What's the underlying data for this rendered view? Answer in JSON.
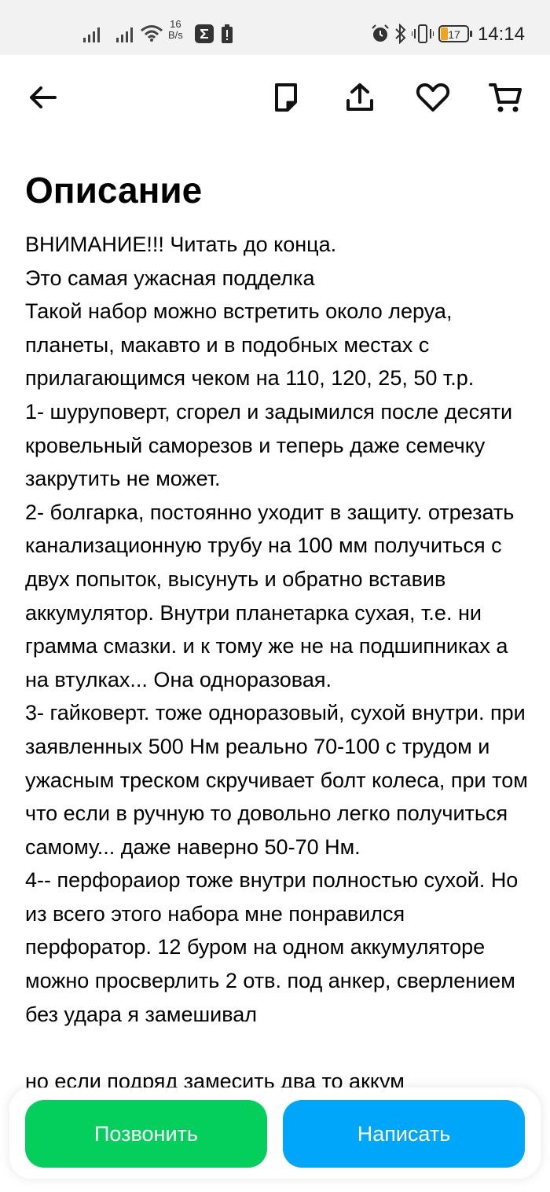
{
  "status_bar": {
    "net_speed_value": "16",
    "net_speed_unit": "B/s",
    "battery_level": "17",
    "time": "14:14",
    "icons": [
      "signal-icon",
      "signal-icon",
      "wifi-icon",
      "sigma-app-icon",
      "battery-warning-icon",
      "alarm-icon",
      "bluetooth-icon",
      "vibrate-icon",
      "battery-icon"
    ]
  },
  "toolbar": {
    "icons": [
      "back-arrow-icon",
      "note-icon",
      "share-icon",
      "favorite-heart-icon",
      "cart-icon"
    ]
  },
  "section": {
    "title": "Описание"
  },
  "description": {
    "text": "ВНИМАНИЕ!!! Читать до конца.\nЭто самая ужасная подделка\nТакой набор можно встретить около леруа, планеты, макавто и в подобных местах с прилагающимся чеком на 110, 120, 25, 50 т.р.\n1- шуруповерт, сгорел и задымился после десяти кровельный саморезов и теперь даже семечку закрутить не может.\n2- болгарка, постоянно уходит в защиту. отрезать канализационную трубу на 100 мм получиться с двух попыток, высунуть и обратно вставив аккумулятор. Внутри планетарка сухая, т.е. ни грамма смазки. и к тому же не на подшипниках а на втулках... Она одноразовая.\n3- гайковерт. тоже одноразовый, сухой внутри. при заявленных 500 Нм реально 70-100 с трудом и ужасным треском скручивает болт колеса, при том что если в ручную то довольно легко получиться самому... даже наверно 50-70 Нм.\n4-- перфораиор тоже внутри полностью сухой. Но из всего этого набора мне понравился перфоратор. 12 буром на одном аккумуляторе можно просверлить 2 отв. под анкер, сверлением без удара я замешивал\n\nно если подряд замесить два то аккум"
  },
  "actions": {
    "call_label": "Позвонить",
    "write_label": "Написать"
  }
}
